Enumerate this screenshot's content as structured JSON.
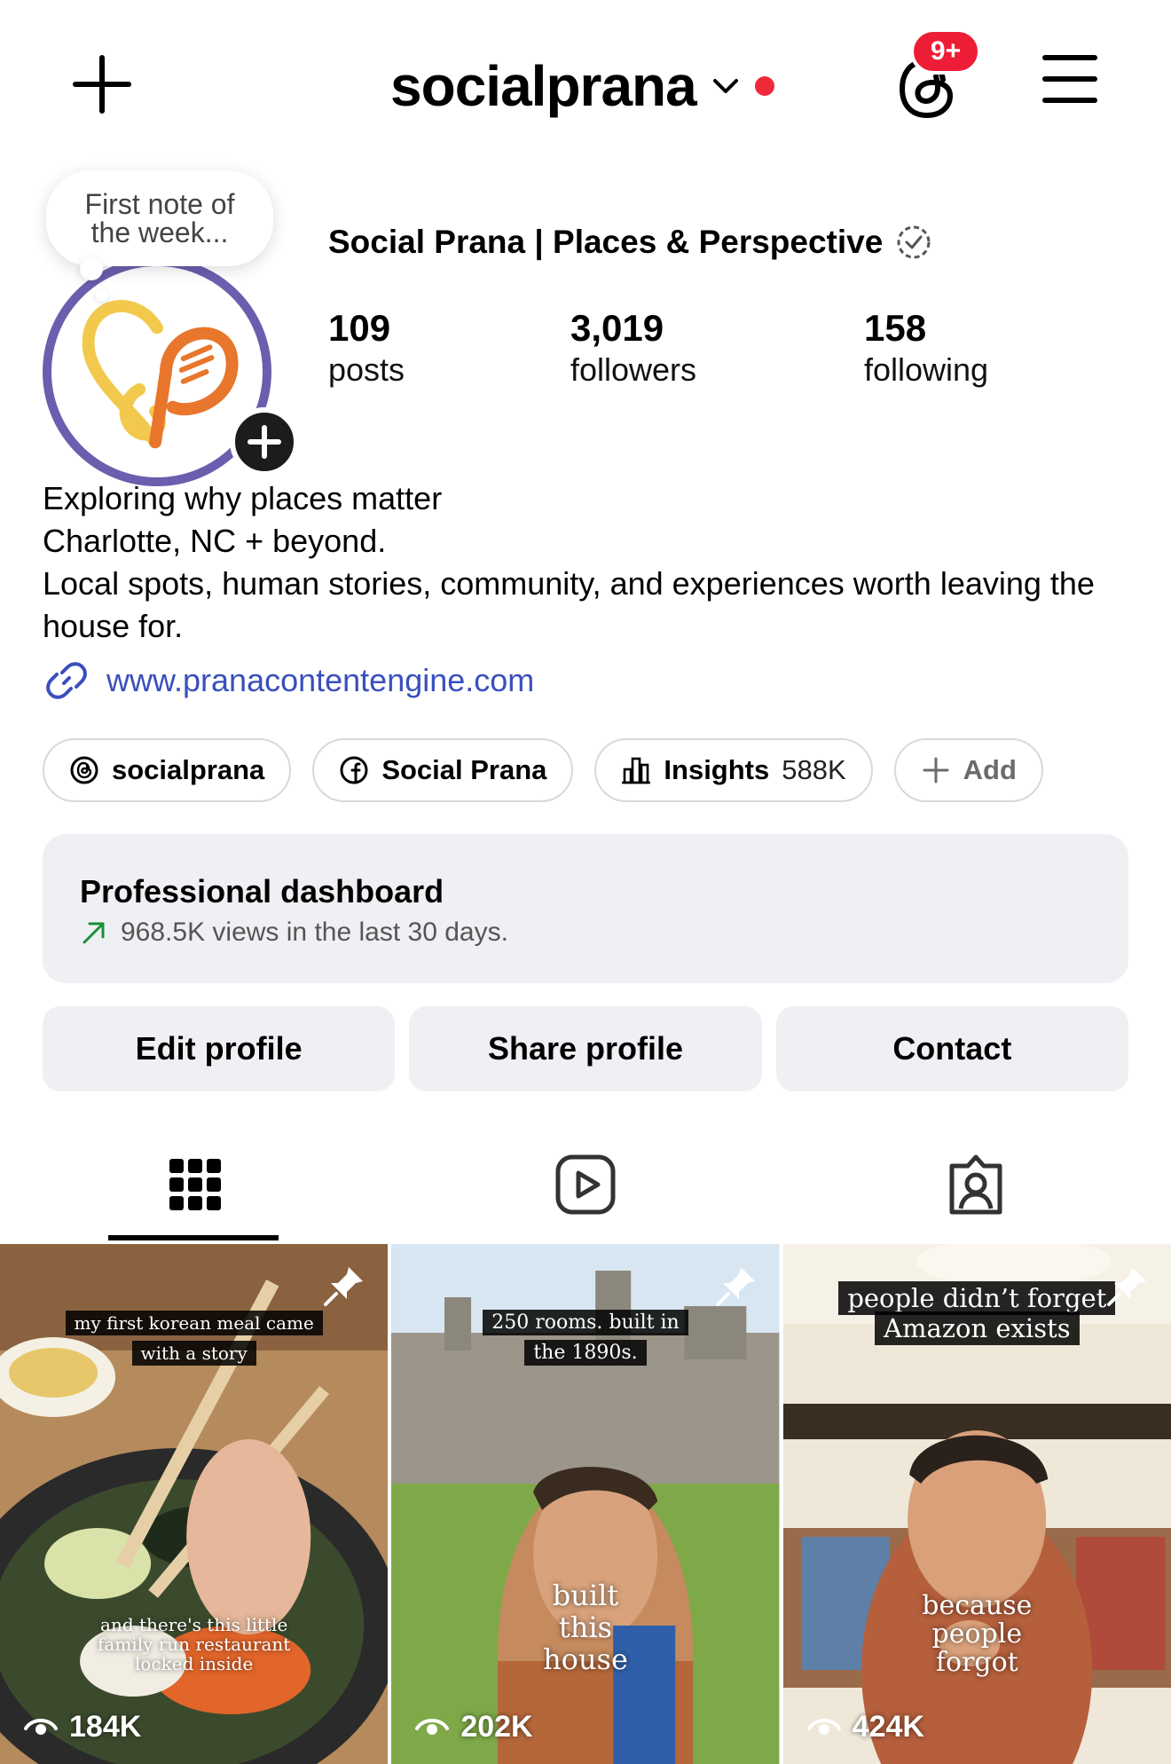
{
  "topbar": {
    "username": "socialprana",
    "notification_badge": "9+",
    "accent_red": "#ee1d36",
    "icons": [
      "plus-icon",
      "chevron-down-icon",
      "threads-icon",
      "menu-icon"
    ]
  },
  "profile": {
    "note_line1": "First note of",
    "note_line2": "the week...",
    "display_name": "Social Prana | Places & Perspective",
    "stats": {
      "posts_count": "109",
      "posts_label": "posts",
      "followers_count": "3,019",
      "followers_label": "followers",
      "following_count": "158",
      "following_label": "following"
    },
    "bio_lines": [
      "Exploring why places matter",
      "Charlotte, NC + beyond.",
      "Local spots, human stories, community, and experiences worth leaving the house for."
    ],
    "link": "www.pranacontentengine.com",
    "link_color": "#3a4fbd"
  },
  "chips": {
    "threads_label": "socialprana",
    "facebook_label": "Social Prana",
    "insights_label": "Insights",
    "insights_value": "588K",
    "add_label": "Add"
  },
  "dashboard": {
    "title": "Professional dashboard",
    "subtitle": "968.5K views in the last 30 days.",
    "trend_color": "#1a8f3a"
  },
  "actions": {
    "edit": "Edit profile",
    "share": "Share profile",
    "contact": "Contact"
  },
  "tabs": [
    "grid-icon",
    "reels-icon",
    "tagged-icon"
  ],
  "posts": [
    {
      "top_caption_1": "my first korean meal came",
      "top_caption_2": "with a story",
      "bottom_caption_1": "and there's this little",
      "bottom_caption_2": "family run restaurant",
      "bottom_caption_3": "locked inside",
      "views": "184K",
      "pinned": true
    },
    {
      "top_caption_1": "250 rooms. built in",
      "top_caption_2": "the 1890s.",
      "bottom_caption_1": "built",
      "bottom_caption_2": "this",
      "bottom_caption_3": "house",
      "views": "202K",
      "pinned": true
    },
    {
      "top_caption_1": "people didn’t forget",
      "top_caption_2": "Amazon exists",
      "bottom_caption_1": "because",
      "bottom_caption_2": "people",
      "bottom_caption_3": "forgot",
      "views": "424K",
      "pinned": true
    }
  ]
}
